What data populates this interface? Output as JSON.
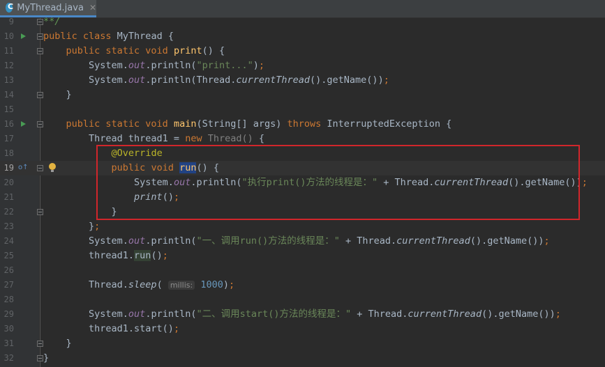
{
  "tab": {
    "file_name": "MyThread.java",
    "close_glyph": "✕"
  },
  "colors": {
    "keyword": "#cc7832",
    "method": "#ffc66d",
    "string": "#6a8759",
    "number": "#6897bb",
    "annotation": "#bbb529",
    "field": "#9876aa",
    "highlight_box": "#d1262b"
  },
  "icons": {
    "file": "java-class-icon",
    "run": "run-gutter-icon",
    "override": "override-gutter-icon",
    "intention": "lightbulb-icon"
  },
  "lines": [
    {
      "num": "9",
      "tokens": [
        {
          "c": "cm",
          "t": "**/"
        }
      ]
    },
    {
      "num": "10",
      "tokens": [
        {
          "c": "kw",
          "t": "public class "
        },
        {
          "c": "",
          "t": "MyThread {"
        }
      ]
    },
    {
      "num": "11",
      "tokens": [
        {
          "c": "",
          "t": "    "
        },
        {
          "c": "kw",
          "t": "public static void "
        },
        {
          "c": "mt",
          "t": "print"
        },
        {
          "c": "",
          "t": "() {"
        }
      ]
    },
    {
      "num": "12",
      "tokens": [
        {
          "c": "",
          "t": "        System."
        },
        {
          "c": "fld",
          "t": "out"
        },
        {
          "c": "",
          "t": ".println("
        },
        {
          "c": "st",
          "t": "\"print...\""
        },
        {
          "c": "",
          "t": ")"
        },
        {
          "c": "kw",
          "t": ";"
        }
      ]
    },
    {
      "num": "13",
      "tokens": [
        {
          "c": "",
          "t": "        System."
        },
        {
          "c": "fld",
          "t": "out"
        },
        {
          "c": "",
          "t": ".println(Thread."
        },
        {
          "c": "sm",
          "t": "currentThread"
        },
        {
          "c": "",
          "t": "().getName())"
        },
        {
          "c": "kw",
          "t": ";"
        }
      ]
    },
    {
      "num": "14",
      "tokens": [
        {
          "c": "",
          "t": "    }"
        }
      ]
    },
    {
      "num": "15",
      "tokens": []
    },
    {
      "num": "16",
      "tokens": [
        {
          "c": "",
          "t": "    "
        },
        {
          "c": "kw",
          "t": "public static void "
        },
        {
          "c": "mt",
          "t": "main"
        },
        {
          "c": "",
          "t": "(String[] args) "
        },
        {
          "c": "kw",
          "t": "throws "
        },
        {
          "c": "",
          "t": "InterruptedException {"
        }
      ]
    },
    {
      "num": "17",
      "tokens": [
        {
          "c": "",
          "t": "        Thread thread1 = "
        },
        {
          "c": "kw",
          "t": "new "
        },
        {
          "c": "dim",
          "t": "Thread() "
        },
        {
          "c": "",
          "t": "{"
        }
      ]
    },
    {
      "num": "18",
      "tokens": [
        {
          "c": "",
          "t": "            "
        },
        {
          "c": "ann",
          "t": "@Override"
        }
      ]
    },
    {
      "num": "19",
      "tokens": [
        {
          "c": "",
          "t": "            "
        },
        {
          "c": "kw",
          "t": "public void "
        },
        {
          "c": "mt hl",
          "t": "run"
        },
        {
          "c": "",
          "t": "() {"
        }
      ]
    },
    {
      "num": "20",
      "tokens": [
        {
          "c": "",
          "t": "                System."
        },
        {
          "c": "fld",
          "t": "out"
        },
        {
          "c": "",
          "t": ".println("
        },
        {
          "c": "st",
          "t": "\"执行print()方法的线程是：\""
        },
        {
          "c": "",
          "t": " + Thread."
        },
        {
          "c": "sm",
          "t": "currentThread"
        },
        {
          "c": "",
          "t": "().getName())"
        },
        {
          "c": "kw",
          "t": ";"
        }
      ]
    },
    {
      "num": "21",
      "tokens": [
        {
          "c": "",
          "t": "                "
        },
        {
          "c": "sm",
          "t": "print"
        },
        {
          "c": "",
          "t": "()"
        },
        {
          "c": "kw",
          "t": ";"
        }
      ]
    },
    {
      "num": "22",
      "tokens": [
        {
          "c": "",
          "t": "            }"
        }
      ]
    },
    {
      "num": "23",
      "tokens": [
        {
          "c": "",
          "t": "        }"
        },
        {
          "c": "kw",
          "t": ";"
        }
      ]
    },
    {
      "num": "24",
      "tokens": [
        {
          "c": "",
          "t": "        System."
        },
        {
          "c": "fld",
          "t": "out"
        },
        {
          "c": "",
          "t": ".println("
        },
        {
          "c": "st",
          "t": "\"一、调用run()方法的线程是：\""
        },
        {
          "c": "",
          "t": " + Thread."
        },
        {
          "c": "sm",
          "t": "currentThread"
        },
        {
          "c": "",
          "t": "().getName())"
        },
        {
          "c": "kw",
          "t": ";"
        }
      ]
    },
    {
      "num": "25",
      "tokens": [
        {
          "c": "",
          "t": "        thread1."
        },
        {
          "c": "hl2",
          "t": "run"
        },
        {
          "c": "",
          "t": "()"
        },
        {
          "c": "kw",
          "t": ";"
        }
      ]
    },
    {
      "num": "26",
      "tokens": []
    },
    {
      "num": "27",
      "tokens": [
        {
          "c": "",
          "t": "        Thread."
        },
        {
          "c": "sm",
          "t": "sleep"
        },
        {
          "c": "",
          "t": "( "
        },
        {
          "c": "hint",
          "t": "millis:"
        },
        {
          "c": "",
          "t": " "
        },
        {
          "c": "num",
          "t": "1000"
        },
        {
          "c": "",
          "t": ")"
        },
        {
          "c": "kw",
          "t": ";"
        }
      ]
    },
    {
      "num": "28",
      "tokens": []
    },
    {
      "num": "29",
      "tokens": [
        {
          "c": "",
          "t": "        System."
        },
        {
          "c": "fld",
          "t": "out"
        },
        {
          "c": "",
          "t": ".println("
        },
        {
          "c": "st",
          "t": "\"二、调用start()方法的线程是：\""
        },
        {
          "c": "",
          "t": " + Thread."
        },
        {
          "c": "sm",
          "t": "currentThread"
        },
        {
          "c": "",
          "t": "().getName())"
        },
        {
          "c": "kw",
          "t": ";"
        }
      ]
    },
    {
      "num": "30",
      "tokens": [
        {
          "c": "",
          "t": "        thread1.start()"
        },
        {
          "c": "kw",
          "t": ";"
        }
      ]
    },
    {
      "num": "31",
      "tokens": [
        {
          "c": "",
          "t": "    }"
        }
      ]
    },
    {
      "num": "32",
      "tokens": [
        {
          "c": "",
          "t": "}"
        }
      ]
    }
  ]
}
